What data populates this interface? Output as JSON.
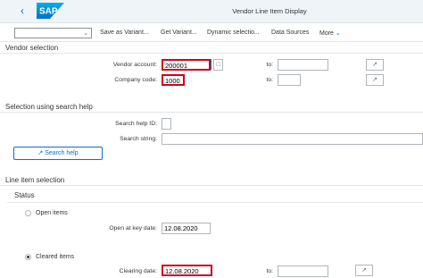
{
  "shell": {
    "logo": "SAP",
    "title": "Vendor Line Item Display",
    "back_icon": "chevron-left"
  },
  "toolbar": {
    "variant_value": "",
    "save_variant": "Save as Variant...",
    "get_variant": "Get Variant...",
    "dynamic_selection": "Dynamic selectio...",
    "data_sources": "Data Sources",
    "more": "More"
  },
  "vendor_selection": {
    "heading": "Vendor selection",
    "vendor_account_label": "Vendor account:",
    "vendor_account_value": "200001",
    "company_code_label": "Company code:",
    "company_code_value": "1000",
    "to_label": "to:"
  },
  "search_help": {
    "heading": "Selection using search help",
    "search_help_id_label": "Search help ID:",
    "search_string_label": "Search string:",
    "button_label": "Search help"
  },
  "line_item_selection": {
    "heading": "Line item selection",
    "status_label": "Status",
    "open_items_label": "Open items",
    "open_items_selected": false,
    "open_key_date_label": "Open at key date:",
    "open_key_date_value": "12.08.2020",
    "cleared_items_label": "Cleared items",
    "cleared_items_selected": true,
    "clearing_date_label": "Clearing date:",
    "clearing_date_value": "12.08.2020",
    "to_label": "to:"
  },
  "colors": {
    "brand": "#0a6ed1",
    "highlight": "#d0021b",
    "shell_bg": "#eff4f9"
  }
}
